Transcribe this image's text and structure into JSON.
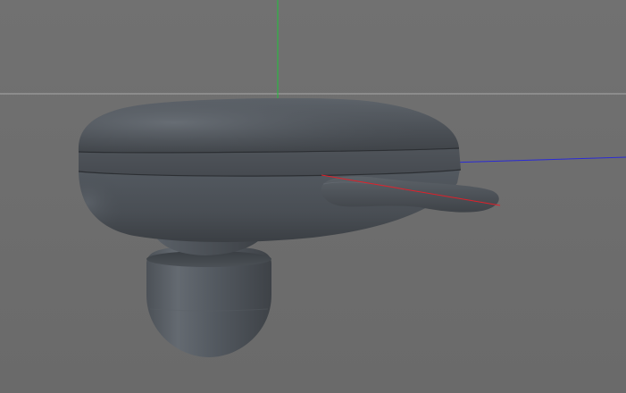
{
  "viewport": {
    "view": "perspective",
    "background_color": "#6e6e6e",
    "grid_line_color": "#a9a9a9",
    "axes": {
      "x_color": "#e0202a",
      "y_color": "#1fc23a",
      "z_color": "#2a2ad6"
    },
    "object": {
      "name": "earbud-model",
      "material_color": "#4f545a",
      "shading": "smooth"
    }
  }
}
